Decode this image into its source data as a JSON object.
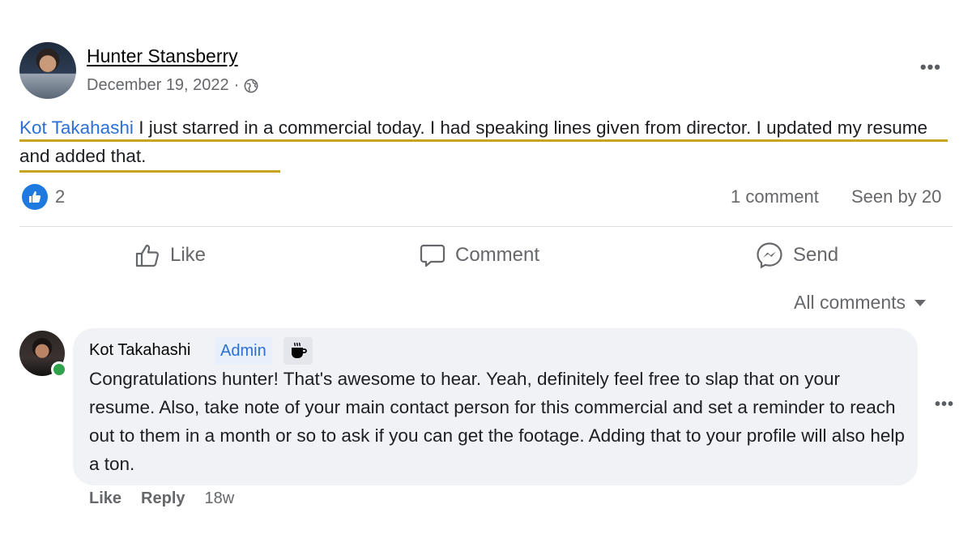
{
  "post": {
    "author": "Hunter Stansberry",
    "date": "December 19, 2022",
    "separator": "·",
    "more": "•••",
    "mention": "Kot Takahashi",
    "text": " I just starred in a commercial today. I had speaking lines given from director. I updated my resume and added that.",
    "reaction_count": "2",
    "comment_count": "1 comment",
    "seen_by": "Seen by 20"
  },
  "actions": {
    "like": "Like",
    "comment": "Comment",
    "send": "Send"
  },
  "comments_filter": "All comments",
  "comment": {
    "author": "Kot Takahashi",
    "badge": "Admin",
    "text": "Congratulations hunter! That's awesome to hear. Yeah, definitely feel free to slap that on your resume. Also, take note of your main contact person for this commercial and set a reminder to reach out to them in a month or so to ask if you can get the footage. Adding that to your profile will also help a ton.",
    "more": "•••",
    "like": "Like",
    "reply": "Reply",
    "age": "18w"
  },
  "icons": {
    "globe": "globe-icon",
    "like_reaction": "thumbs-up-icon",
    "like_action": "thumbs-up-outline-icon",
    "comment_action": "speech-bubble-icon",
    "send_action": "messenger-icon",
    "caret": "caret-down-icon",
    "badge_cup": "coffee-cup-icon"
  },
  "colors": {
    "accent": "#2d6fd6",
    "highlight": "#c8a521",
    "online": "#31a24c",
    "bubble": "#f0f2f5"
  }
}
